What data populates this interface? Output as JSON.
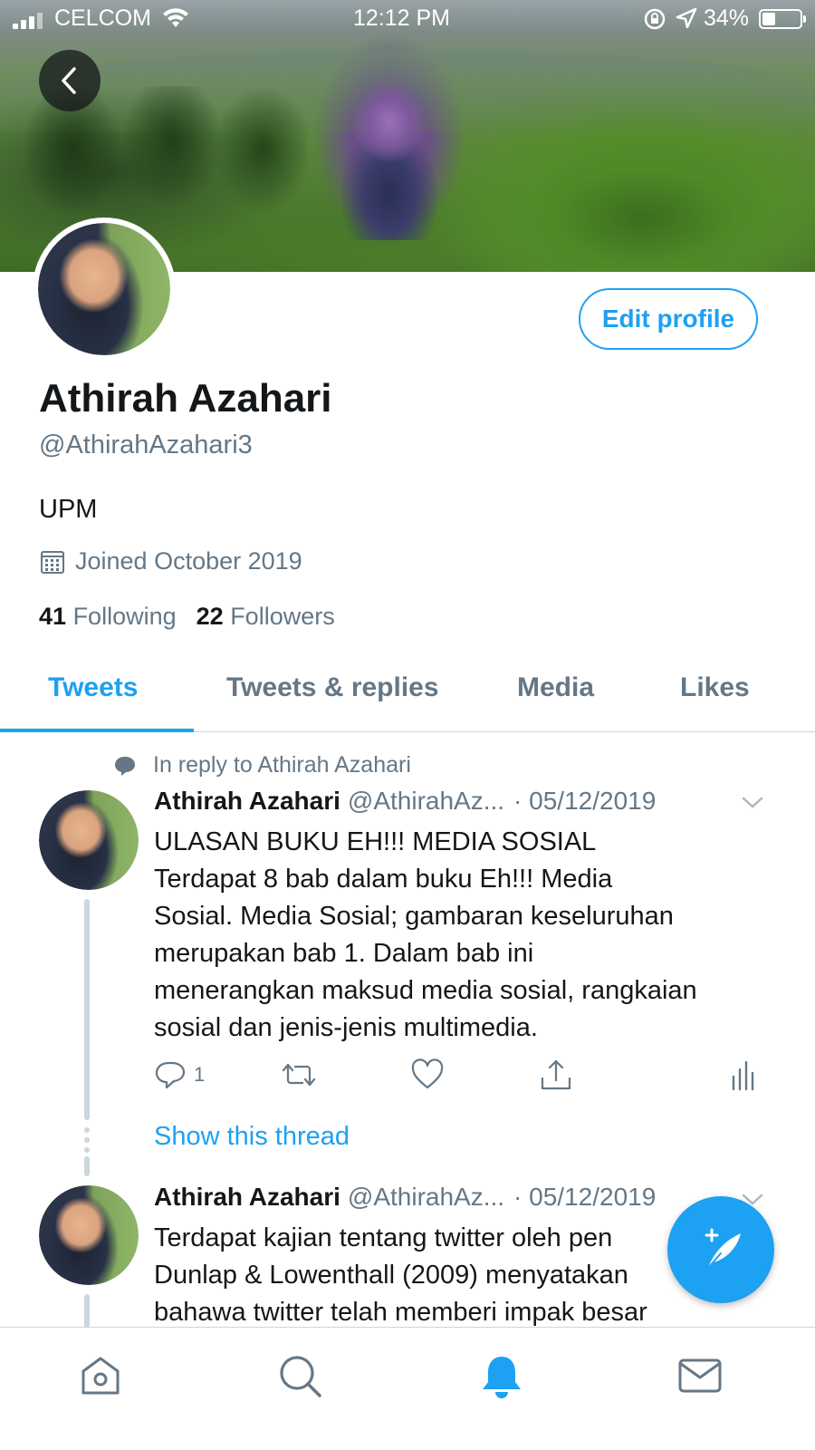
{
  "status_bar": {
    "carrier": "CELCOM",
    "time": "12:12 PM",
    "battery_percent": "34%",
    "battery_level": 0.34
  },
  "profile": {
    "name": "Athirah Azahari",
    "handle": "@AthirahAzahari3",
    "bio": "UPM",
    "joined": "Joined October 2019",
    "following_count": "41",
    "following_label": "Following",
    "followers_count": "22",
    "followers_label": "Followers",
    "edit_label": "Edit profile"
  },
  "tabs": [
    {
      "label": "Tweets",
      "active": true
    },
    {
      "label": "Tweets & replies",
      "active": false
    },
    {
      "label": "Media",
      "active": false
    },
    {
      "label": "Likes",
      "active": false
    }
  ],
  "tweets": [
    {
      "reply_context": "In reply to Athirah Azahari",
      "author": "Athirah Azahari",
      "handle": "@AthirahAz...",
      "date": "· 05/12/2019",
      "lines": [
        "ULASAN BUKU EH!!! MEDIA SOSIAL",
        "Terdapat 8 bab dalam buku Eh!!! Media",
        "Sosial. Media Sosial; gambaran keseluruhan",
        "merupakan bab 1. Dalam bab ini",
        "menerangkan maksud media sosial, rangkaian",
        "sosial dan jenis-jenis multimedia."
      ],
      "reply_count": "1",
      "show_thread": "Show this thread"
    },
    {
      "author": "Athirah Azahari",
      "handle": "@AthirahAz...",
      "date": "· 05/12/2019",
      "lines": [
        "Terdapat kajian tentang twitter oleh pen",
        "Dunlap & Lowenthall (2009) menyatakan",
        "bahawa twitter telah memberi impak besar"
      ]
    }
  ],
  "icons": {
    "back": "chevron-left-icon",
    "calendar": "calendar-icon",
    "reply": "reply-icon",
    "retweet": "retweet-icon",
    "like": "heart-icon",
    "share": "share-icon",
    "analytics": "analytics-icon",
    "compose": "compose-tweet-icon",
    "home": "home-icon",
    "search": "search-icon",
    "notifications": "bell-icon",
    "messages": "mail-icon"
  },
  "colors": {
    "accent": "#1da1f2",
    "secondary_text": "#657786",
    "primary_text": "#14171a"
  }
}
